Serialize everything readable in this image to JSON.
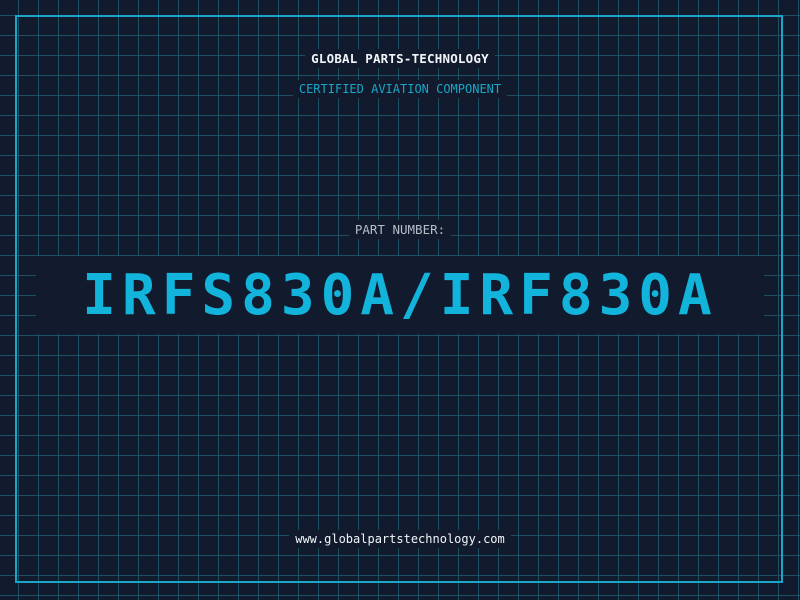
{
  "header": {
    "company": "GLOBAL PARTS-TECHNOLOGY",
    "certification": "CERTIFIED AVIATION COMPONENT"
  },
  "part": {
    "label": "PART NUMBER:",
    "number": "IRFS830A/IRF830A"
  },
  "footer": {
    "url": "www.globalpartstechnology.com"
  },
  "colors": {
    "background": "#121b2e",
    "grid": "#1d5063",
    "accent": "#1aa6c6",
    "part_number": "#13b4dc",
    "text": "#f2f5f8",
    "label": "#b4bcc8"
  }
}
